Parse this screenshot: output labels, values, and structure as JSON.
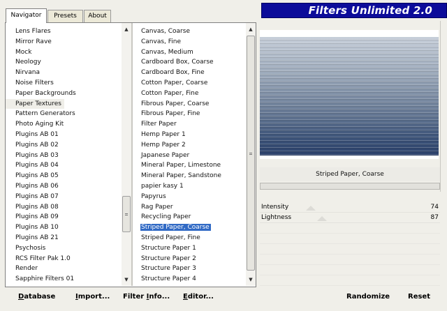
{
  "tabs": [
    {
      "label": "Navigator",
      "active": true
    },
    {
      "label": "Presets",
      "active": false
    },
    {
      "label": "About",
      "active": false
    }
  ],
  "banner": {
    "title": "Filters Unlimited 2.0"
  },
  "categories": [
    "Lens Flares",
    "Mirror Rave",
    "Mock",
    "Neology",
    "Nirvana",
    "Noise Filters",
    "Paper Backgrounds",
    "Paper Textures",
    "Pattern Generators",
    "Photo Aging Kit",
    "Plugins AB 01",
    "Plugins AB 02",
    "Plugins AB 03",
    "Plugins AB 04",
    "Plugins AB 05",
    "Plugins AB 06",
    "Plugins AB 07",
    "Plugins AB 08",
    "Plugins AB 09",
    "Plugins AB 10",
    "Plugins AB 21",
    "Psychosis",
    "RCS Filter Pak 1.0",
    "Render",
    "Sapphire Filters 01"
  ],
  "selected_category": "Paper Textures",
  "filters": [
    "Canvas, Coarse",
    "Canvas, Fine",
    "Canvas, Medium",
    "Cardboard Box, Coarse",
    "Cardboard Box, Fine",
    "Cotton Paper, Coarse",
    "Cotton Paper, Fine",
    "Fibrous Paper, Coarse",
    "Fibrous Paper, Fine",
    "Filter Paper",
    "Hemp Paper 1",
    "Hemp Paper 2",
    "Japanese Paper",
    "Mineral Paper, Limestone",
    "Mineral Paper, Sandstone",
    "papier kasy 1",
    "Papyrus",
    "Rag Paper",
    "Recycling Paper",
    "Striped Paper, Coarse",
    "Striped Paper, Fine",
    "Structure Paper 1",
    "Structure Paper 2",
    "Structure Paper 3",
    "Structure Paper 4"
  ],
  "selected_filter": "Striped Paper, Coarse",
  "filter_name": "Striped Paper, Coarse",
  "params": [
    {
      "label": "Intensity",
      "value": "74"
    },
    {
      "label": "Lightness",
      "value": "87"
    }
  ],
  "buttons": {
    "database": {
      "u": "D",
      "rest": "atabase"
    },
    "import": {
      "u": "I",
      "rest": "mport..."
    },
    "filterinfo": {
      "pre": "Filter ",
      "u": "I",
      "rest": "nfo..."
    },
    "editor": {
      "u": "E",
      "rest": "ditor..."
    },
    "randomize": "Randomize",
    "reset": "Reset"
  },
  "colors": {
    "banner": "#0c0c9a",
    "selection": "#316ac5"
  }
}
